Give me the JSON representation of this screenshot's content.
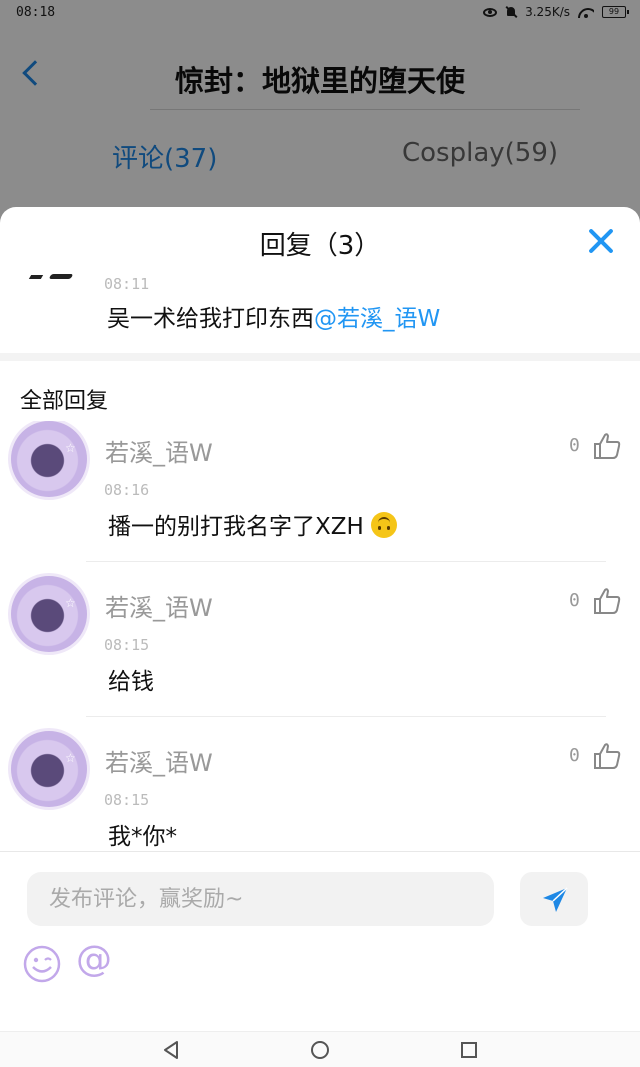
{
  "status_bar": {
    "time": "08:18",
    "net_speed": "3.25K/s",
    "battery": "99"
  },
  "header": {
    "title": "惊封：地狱里的堕天使"
  },
  "tabs": [
    {
      "label": "评论(37)",
      "active": true
    },
    {
      "label": "Cosplay(59)",
      "active": false
    }
  ],
  "reply_sheet": {
    "title": "回复（3）",
    "original_comment": {
      "time": "08:11",
      "text": "吴一术给我打印东西",
      "mention": "@若溪_语W"
    },
    "section_title": "全部回复",
    "replies": [
      {
        "user": "若溪_语W",
        "time": "08:16",
        "text": "播一的别打我名字了XZH",
        "likes": "0",
        "emoji": "upside-down-face"
      },
      {
        "user": "若溪_语W",
        "time": "08:15",
        "text": "给钱",
        "likes": "0"
      },
      {
        "user": "若溪_语W",
        "time": "08:15",
        "text": "我*你*",
        "likes": "0"
      }
    ]
  },
  "composer": {
    "placeholder": "发布评论，赢奖励~",
    "value": "",
    "at_symbol": "@"
  },
  "colors": {
    "accent": "#1e88e5",
    "close": "#2196f3",
    "overlay": "rgba(0,0,0,0.45)",
    "muted_text": "#999999",
    "emoji_tint": "#c2a8ea"
  },
  "icons": {
    "back": "chevron-left-icon",
    "close": "close-icon",
    "like": "thumbs-up-icon",
    "send": "send-arrow-icon",
    "emoji": "smiley-icon",
    "mention": "at-icon"
  }
}
